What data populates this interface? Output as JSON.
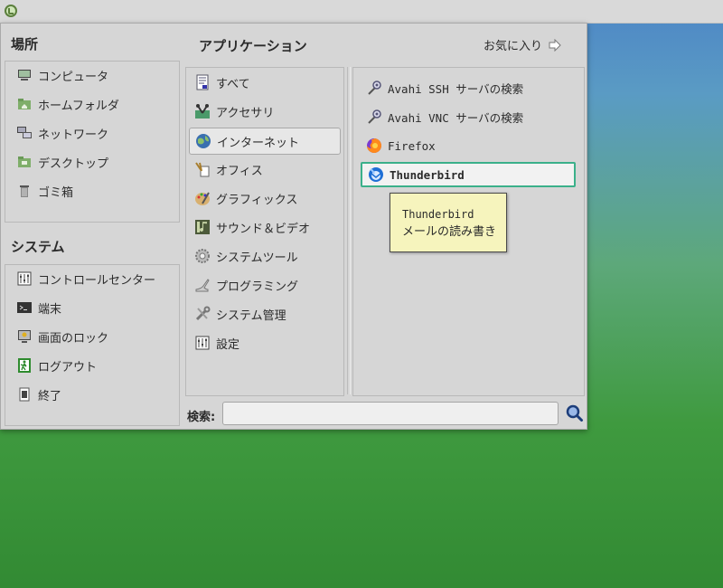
{
  "places": {
    "title": "場所",
    "items": [
      {
        "label": "コンピュータ",
        "icon": "computer-icon"
      },
      {
        "label": "ホームフォルダ",
        "icon": "home-folder-icon"
      },
      {
        "label": "ネットワーク",
        "icon": "network-icon"
      },
      {
        "label": "デスクトップ",
        "icon": "desktop-folder-icon"
      },
      {
        "label": "ゴミ箱",
        "icon": "trash-icon"
      }
    ]
  },
  "system": {
    "title": "システム",
    "items": [
      {
        "label": "コントロールセンター",
        "icon": "control-center-icon"
      },
      {
        "label": "端末",
        "icon": "terminal-icon"
      },
      {
        "label": "画面のロック",
        "icon": "lock-screen-icon"
      },
      {
        "label": "ログアウト",
        "icon": "logout-icon"
      },
      {
        "label": "終了",
        "icon": "shutdown-icon"
      }
    ]
  },
  "applications": {
    "title": "アプリケーション",
    "favorites_label": "お気に入り",
    "categories": [
      {
        "label": "すべて",
        "icon": "all-apps-icon"
      },
      {
        "label": "アクセサリ",
        "icon": "accessories-icon"
      },
      {
        "label": "インターネット",
        "icon": "internet-globe-icon",
        "selected": true
      },
      {
        "label": "オフィス",
        "icon": "office-icon"
      },
      {
        "label": "グラフィックス",
        "icon": "graphics-icon"
      },
      {
        "label": "サウンド＆ビデオ",
        "icon": "sound-video-icon"
      },
      {
        "label": "システムツール",
        "icon": "system-tools-icon"
      },
      {
        "label": "プログラミング",
        "icon": "programming-icon"
      },
      {
        "label": "システム管理",
        "icon": "administration-icon"
      },
      {
        "label": "設定",
        "icon": "settings-icon"
      }
    ],
    "apps": [
      {
        "label": "Avahi SSH サーバの検索",
        "icon": "avahi-ssh-icon"
      },
      {
        "label": "Avahi VNC サーバの検索",
        "icon": "avahi-vnc-icon"
      },
      {
        "label": "Firefox",
        "icon": "firefox-icon"
      },
      {
        "label": "Thunderbird",
        "icon": "thunderbird-icon",
        "selected": true
      }
    ]
  },
  "tooltip": {
    "name": "Thunderbird",
    "description": "メールの読み書き"
  },
  "search": {
    "label": "検索:",
    "value": "",
    "placeholder": ""
  },
  "colors": {
    "accent_selected_border": "#3bb08a",
    "tooltip_background": "#f6f4bd",
    "panel_background": "#d6d6d6"
  }
}
